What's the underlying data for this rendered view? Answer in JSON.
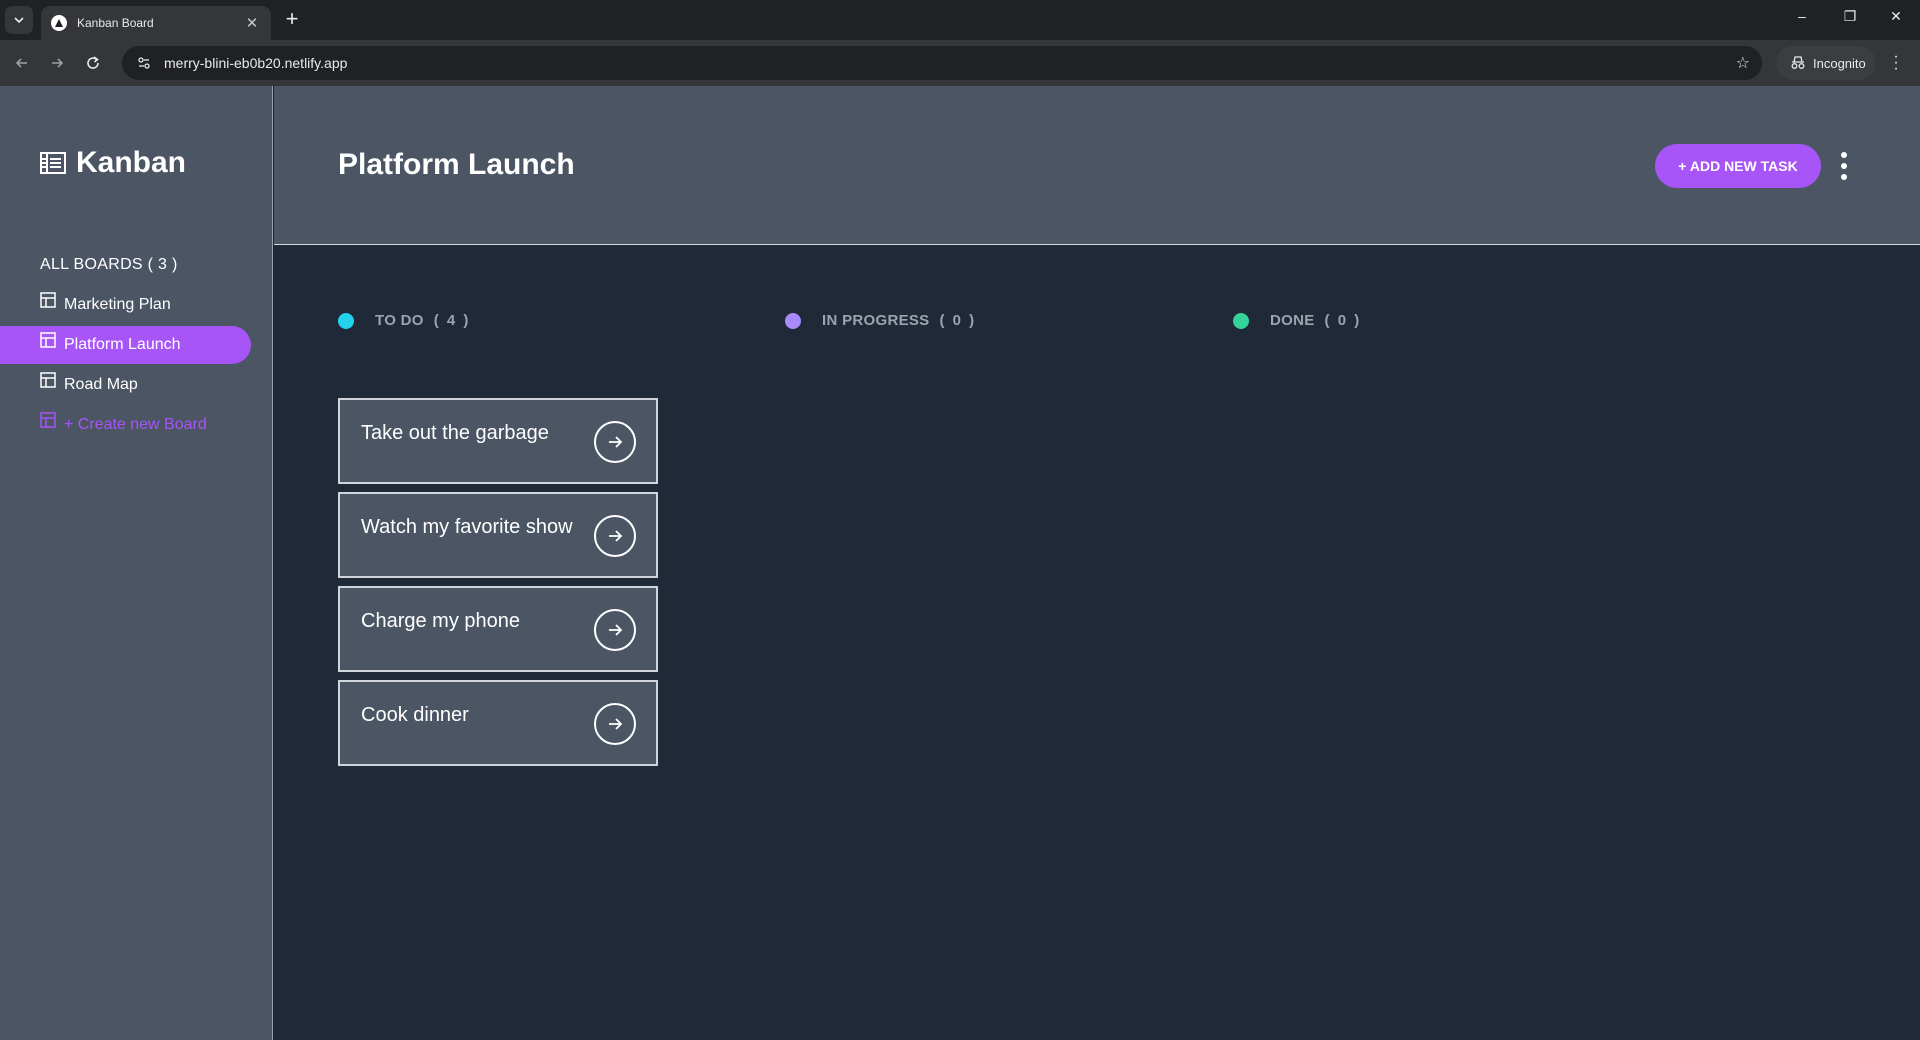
{
  "browser": {
    "tab_title": "Kanban Board",
    "url": "merry-blini-eb0b20.netlify.app",
    "incognito_label": "Incognito"
  },
  "sidebar": {
    "logo_text": "Kanban",
    "boards_heading": "ALL BOARDS ( 3 )",
    "boards": [
      {
        "label": "Marketing Plan",
        "active": false
      },
      {
        "label": "Platform Launch",
        "active": true
      },
      {
        "label": "Road Map",
        "active": false
      }
    ],
    "create_label": "+ Create new Board"
  },
  "header": {
    "title": "Platform Launch",
    "add_task_label": "+ ADD NEW TASK"
  },
  "columns": [
    {
      "name": "TO DO",
      "count": "( 4 )",
      "color": "#22d3ee"
    },
    {
      "name": "IN PROGRESS",
      "count": "( 0 )",
      "color": "#a78bfa"
    },
    {
      "name": "DONE",
      "count": "( 0 )",
      "color": "#34d399"
    }
  ],
  "tasks": [
    {
      "title": "Take out the garbage"
    },
    {
      "title": "Watch my favorite show"
    },
    {
      "title": "Charge my phone"
    },
    {
      "title": "Cook dinner"
    }
  ],
  "colors": {
    "accent": "#a855f7",
    "sidebar_bg": "#4b5563",
    "board_bg": "#1f2937"
  }
}
